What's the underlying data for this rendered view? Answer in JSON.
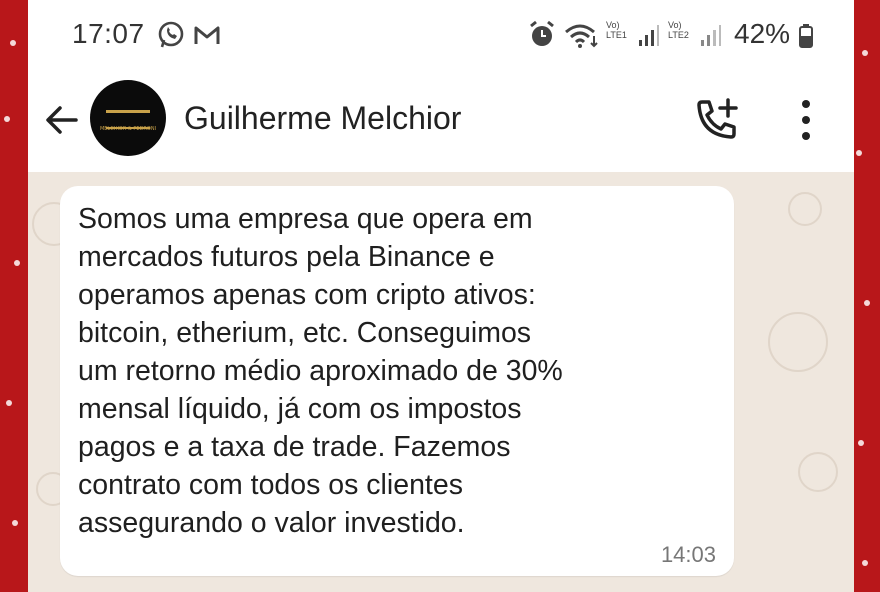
{
  "status_bar": {
    "time": "17:07",
    "signal_label_1": "Vo) LTE1",
    "signal_label_2": "Vo) LTE2",
    "battery": "42%"
  },
  "header": {
    "contact_name": "Guilherme Melchior",
    "avatar_logo_text": "MELCHIOR & PEDRONI"
  },
  "message": {
    "lines": [
      "Somos uma empresa que opera em",
      "mercados futuros pela Binance e",
      "operamos apenas com cripto ativos:",
      "bitcoin, etherium, etc. Conseguimos",
      "um retorno médio aproximado de 30%",
      "mensal líquido, já com os impostos",
      "pagos e a taxa de trade. Fazemos",
      "contrato com todos os clientes",
      "assegurando o valor investido."
    ],
    "time": "14:03"
  },
  "colors": {
    "frame_red": "#b8171a",
    "chat_background": "#efe7de",
    "bubble": "#ffffff"
  },
  "icons": [
    "whatsapp-icon",
    "gmail-icon",
    "alarm-icon",
    "wifi-icon",
    "signal-icon",
    "battery-icon",
    "back-arrow-icon",
    "add-call-icon",
    "more-vert-icon"
  ]
}
